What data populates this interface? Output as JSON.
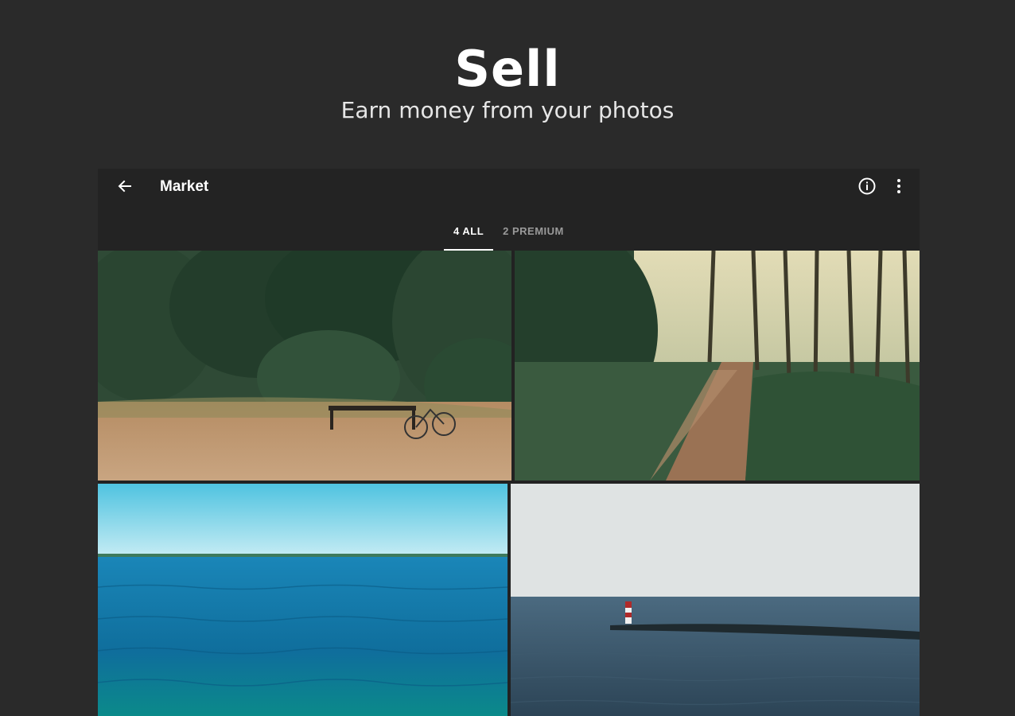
{
  "promo": {
    "title": "Sell",
    "subtitle": "Earn money from your photos"
  },
  "appbar": {
    "title": "Market",
    "back_icon": "arrow-left-icon",
    "info_icon": "info-icon",
    "more_icon": "more-vertical-icon"
  },
  "tabs": [
    {
      "label": "4 ALL",
      "active": true
    },
    {
      "label": "2 PREMIUM",
      "active": false
    }
  ],
  "photos": [
    {
      "subject": "forest clearing with bench and bicycle"
    },
    {
      "subject": "dirt path through forest"
    },
    {
      "subject": "open sea under clear sky"
    },
    {
      "subject": "breakwater with lighthouse"
    }
  ],
  "colors": {
    "background": "#2a2a2a",
    "appbar": "#232323",
    "tab_active": "#ffffff",
    "tab_inactive": "#9a9a9a"
  }
}
